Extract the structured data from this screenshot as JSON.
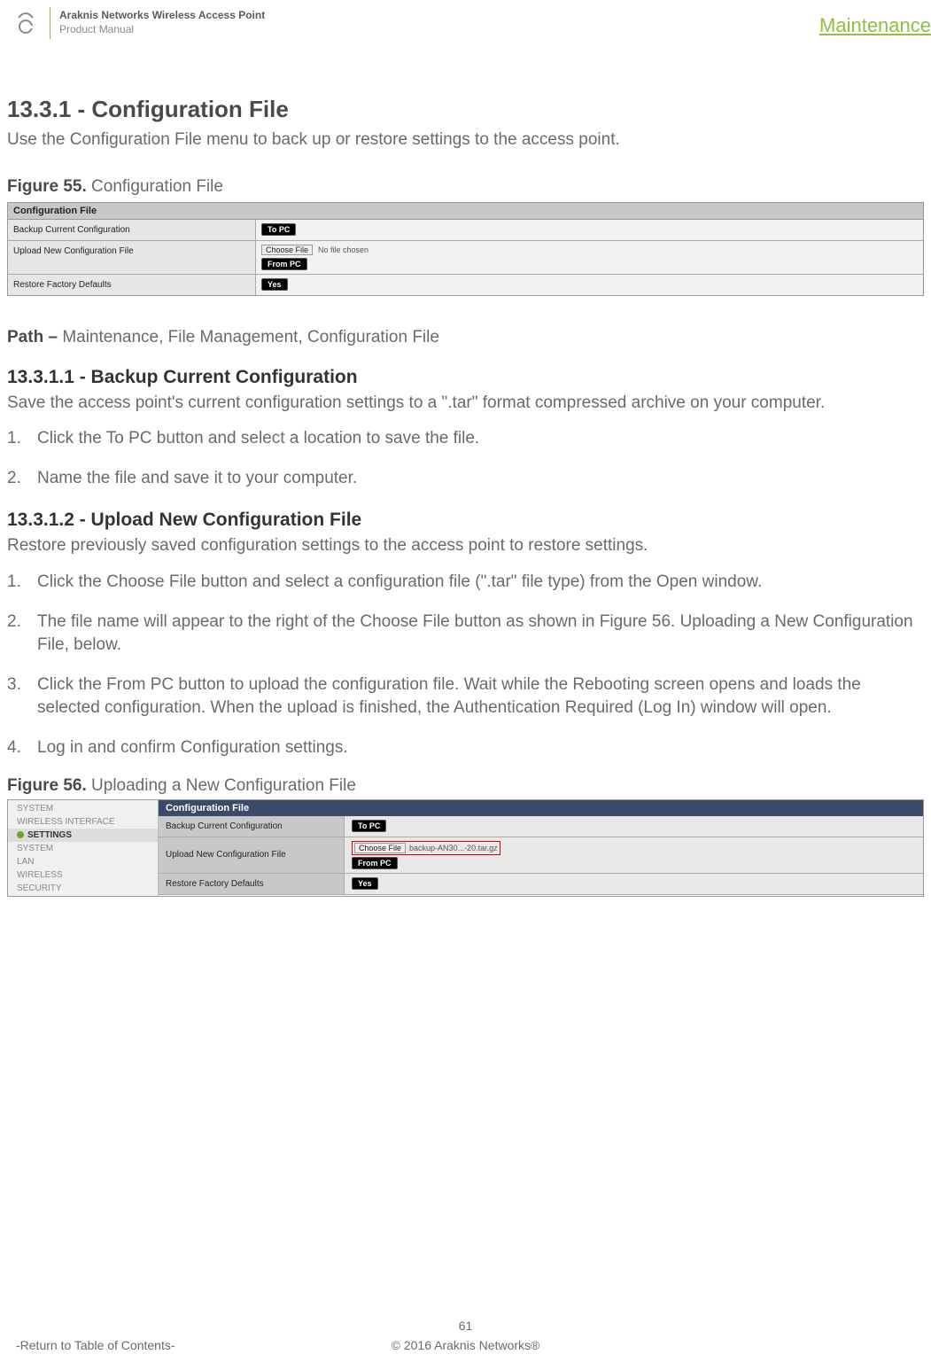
{
  "header": {
    "title": "Araknis Networks Wireless Access Point",
    "subtitle": "Product Manual",
    "section": "Maintenance"
  },
  "s1": {
    "heading": "13.3.1 - Configuration File",
    "text": "Use the Configuration File menu to back up or restore settings to the access point."
  },
  "fig55": {
    "label_bold": "Figure 55.",
    "label_rest": " Configuration File",
    "panel_title": "Configuration File",
    "rows": [
      {
        "label": "Backup Current Configuration",
        "btn": "To PC"
      },
      {
        "label": "Upload New Configuration File",
        "choose": "Choose File",
        "nofile": "No file chosen",
        "btn": "From PC"
      },
      {
        "label": "Restore Factory Defaults",
        "btn": "Yes"
      }
    ]
  },
  "path": {
    "bold": "Path – ",
    "rest": "Maintenance, File Management, Configuration File"
  },
  "s2": {
    "heading": "13.3.1.1 - Backup Current Configuration",
    "text": "Save the access point's current configuration settings to a \".tar\" format compressed archive on your computer.",
    "steps": [
      "Click the To PC button and select a location to save the file.",
      "Name the file and save it to your computer."
    ]
  },
  "s3": {
    "heading": "13.3.1.2 - Upload New Configuration File",
    "text": "Restore previously saved configuration settings to the access point to restore settings.",
    "steps": [
      "Click the Choose File button and select a configuration file (\".tar\" file type) from the Open window.",
      "The file name will appear to the right of the Choose File button as shown in Figure 56. Uploading a New Configuration File, below.",
      "Click the From PC button to upload the configuration file. Wait while the Rebooting screen opens and loads the selected configuration. When the upload is finished, the Authentication Required (Log In) window will open.",
      "Log in and confirm Configuration settings."
    ]
  },
  "fig56": {
    "label_bold": "Figure 56.",
    "label_rest": " Uploading a New Configuration File",
    "side": [
      "SYSTEM",
      "WIRELESS INTERFACE",
      "SETTINGS",
      "SYSTEM",
      "LAN",
      "WIRELESS",
      "SECURITY"
    ],
    "panel_title": "Configuration File",
    "rows": {
      "r1": {
        "label": "Backup Current Configuration",
        "btn": "To PC"
      },
      "r2": {
        "label": "Upload New Configuration File",
        "choose": "Choose File",
        "file": "backup-AN30...-20.tar.gz",
        "btn": "From PC"
      },
      "r3": {
        "label": "Restore Factory Defaults",
        "btn": "Yes"
      }
    }
  },
  "footer": {
    "page": "61",
    "copyright": "© 2016 Araknis Networks®",
    "return": "-Return to Table of Contents-"
  }
}
